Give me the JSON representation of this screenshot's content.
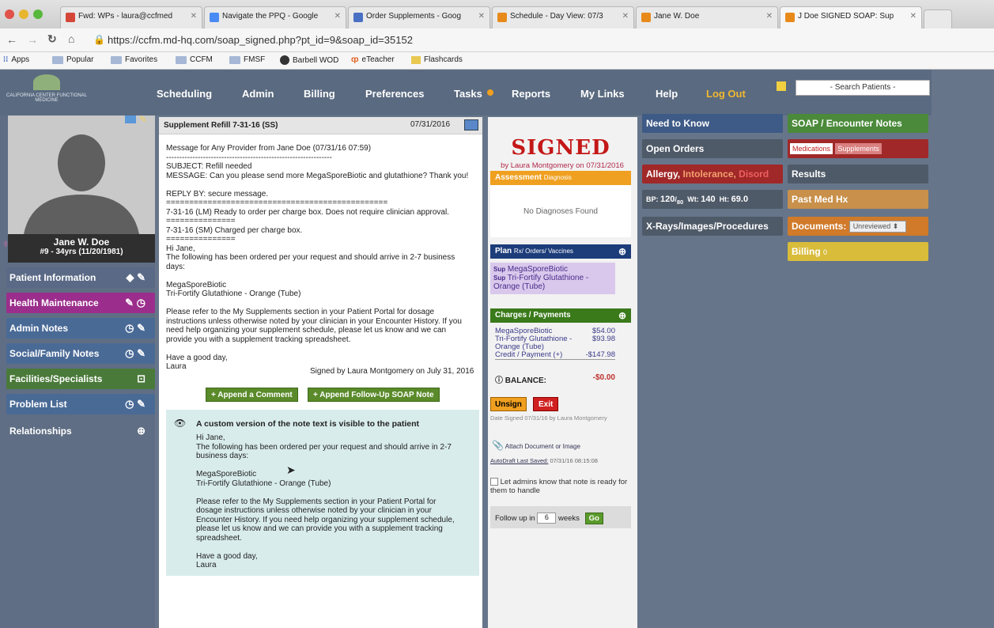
{
  "browser": {
    "tabs": [
      {
        "label": "Fwd: WPs - laura@ccfmed",
        "color": "#d44638"
      },
      {
        "label": "Navigate the PPQ - Google",
        "color": "#4a8af4"
      },
      {
        "label": "Order Supplements - Goog",
        "color": "#4a70c4"
      },
      {
        "label": "Schedule - Day View: 07/3",
        "color": "#e88a1a"
      },
      {
        "label": "Jane W. Doe",
        "color": "#e88a1a"
      },
      {
        "label": "J Doe SIGNED SOAP: Sup",
        "color": "#e88a1a"
      }
    ],
    "url": "https://ccfm.md-hq.com/soap_signed.php?pt_id=9&soap_id=35152",
    "bookmarks": [
      "Apps",
      "Popular",
      "Favorites",
      "CCFM",
      "FMSF",
      "Barbell WOD",
      "eTeacher",
      "Flashcards"
    ]
  },
  "app": {
    "logo_text": "CALIFORNIA CENTER FUNCTIONAL MEDICINE",
    "nav": [
      "Scheduling",
      "Admin",
      "Billing",
      "Preferences",
      "Tasks",
      "Reports",
      "My Links",
      "Help",
      "Log Out"
    ],
    "search_placeholder": "- Search Patients -"
  },
  "patient": {
    "name": "Jane W. Doe",
    "info": "#9 - 34yrs (11/20/1981)"
  },
  "sidebar": [
    {
      "label": "Patient Information",
      "color": "#5a6a86"
    },
    {
      "label": "Health Maintenance",
      "color": "#9b2e8c"
    },
    {
      "label": "Admin Notes",
      "color": "#4a6a96"
    },
    {
      "label": "Social/Family Notes",
      "color": "#4a6a96"
    },
    {
      "label": "Facilities/Specialists",
      "color": "#4a7a3a"
    },
    {
      "label": "Problem List",
      "color": "#4a6a96"
    },
    {
      "label": "Relationships",
      "color": "#5a6a80"
    }
  ],
  "note": {
    "title": "Supplement Refill 7-31-16  (SS)",
    "date": "07/31/2016",
    "type": "Supplement Refill",
    "lines": [
      "Message for Any Provider from Jane Doe (07/31/16 07:59)",
      "---------------------------------------------------------------",
      "SUBJECT: Refill needed",
      "MESSAGE: Can you please send more MegaSporeBiotic and glutathione? Thank you!",
      "",
      "REPLY BY: secure message.",
      "================================================",
      "7-31-16 (LM) Ready to order per charge box. Does not require clinician approval.",
      "===============",
      "7-31-16 (SM) Charged per charge box.",
      "===============",
      "Hi Jane,",
      "The following has been ordered per your request and should arrive in 2-7 business",
      "days:",
      "",
      "MegaSporeBiotic",
      "Tri-Fortify Glutathione - Orange (Tube)",
      "",
      "Please refer to the My Supplements section in your Patient Portal for dosage",
      "instructions unless otherwise noted by your clinician in your Encounter History.  If you",
      "need help organizing your supplement schedule, please let us know and we can",
      "provide you with a supplement tracking spreadsheet.",
      "",
      "Have a good day,",
      "Laura"
    ],
    "signed_by": "Signed by Laura Montgomery on July 31, 2016",
    "append_comment": "+ Append a Comment",
    "append_followup": "+ Append Follow-Up SOAP Note",
    "custom_title": "A custom version of the note text is visible to the patient",
    "custom_lines": [
      "Hi Jane,",
      "The following has been ordered per your request and should arrive in 2-7",
      "business days:",
      "",
      "MegaSporeBiotic",
      "Tri-Fortify Glutathione - Orange (Tube)",
      "",
      "Please refer to the My Supplements section in your Patient Portal for",
      "dosage instructions unless otherwise noted by your clinician in your",
      "Encounter History.  If you need help organizing your supplement schedule,",
      "please let us know and we can provide you with a supplement tracking",
      "spreadsheet.",
      "",
      "Have a good day,",
      "Laura"
    ]
  },
  "middle": {
    "signed": "SIGNED",
    "signed_by": "by Laura Montgomery on 07/31/2016",
    "assessment_title": "Assessment",
    "assessment_sub": "Diagnosis",
    "no_diag": "No Diagnoses Found",
    "plan_title": "Plan",
    "plan_sub": "Rx/ Orders/ Vaccines",
    "plan_items": [
      {
        "tag": "Sup",
        "label": "MegaSporeBiotic"
      },
      {
        "tag": "Sup",
        "label": "Tri-Fortify Glutathione - Orange (Tube)"
      }
    ],
    "charges_title": "Charges / Payments",
    "charges": [
      {
        "label": "MegaSporeBiotic",
        "amount": "$54.00"
      },
      {
        "label": "Tri-Fortify Glutathione - Orange (Tube)",
        "amount": "$93.98"
      },
      {
        "label": "Credit / Payment (+)",
        "amount": "-$147.98"
      }
    ],
    "balance_label": "BALANCE:",
    "balance_value": "-$0.00",
    "unsign": "Unsign",
    "exit": "Exit",
    "date_signed": "Date Signed 07/31/16 by Laura Montgomery",
    "attach": "Attach Document or Image",
    "autodraft_label": "AutoDraft Last Saved:",
    "autodraft_value": "07/31/16 08:15:08",
    "admin_check": "Let admins know that note is ready for them to handle",
    "followup_label": "Follow up in",
    "followup_value": "6",
    "followup_unit": "weeks",
    "go": "Go"
  },
  "right": {
    "need_to_know": "Need to Know",
    "open_orders": "Open Orders",
    "allergy": "Allergy,",
    "intolerance": "Intolerance,",
    "disorder": "Disord",
    "vitals": {
      "bp_label": "BP:",
      "bp_top": "120",
      "bp_bottom": "80",
      "wt_label": "Wt:",
      "wt": "140",
      "ht_label": "Ht:",
      "ht": "69.0"
    },
    "xrays": "X-Rays/Images/Procedures",
    "soap": "SOAP / Encounter Notes",
    "medications": "Medications",
    "supplements": "Supplements",
    "results": "Results",
    "past_med": "Past Med Hx",
    "documents": "Documents:",
    "documents_filter": "Unreviewed",
    "billing": "Billing",
    "billing_count": "0"
  }
}
